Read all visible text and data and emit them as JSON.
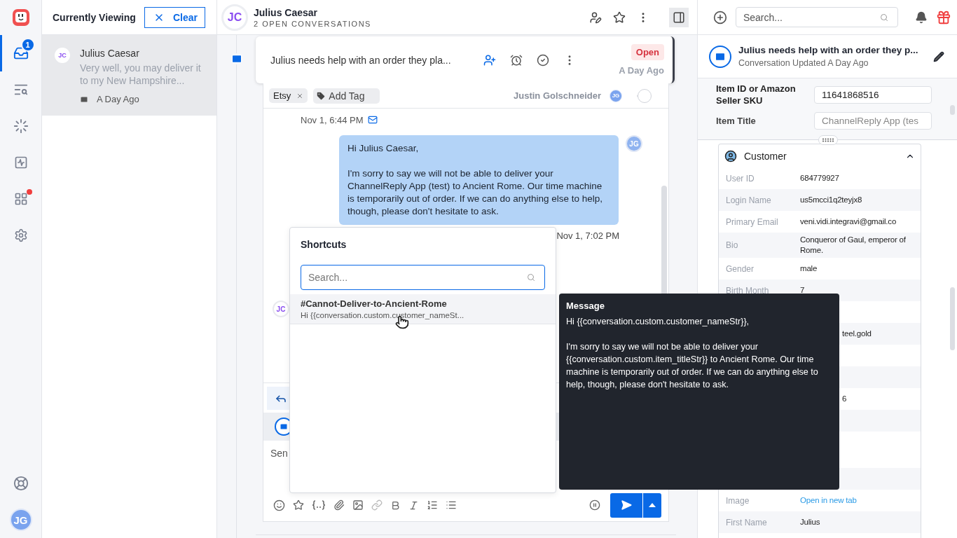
{
  "rail": {
    "items": [
      {
        "kind": "inbox",
        "selected": true,
        "badge": "1",
        "alert": false
      },
      {
        "kind": "search",
        "selected": false,
        "alert": false
      },
      {
        "kind": "reports",
        "selected": false,
        "alert": false
      },
      {
        "kind": "activity",
        "selected": false,
        "alert": false
      },
      {
        "kind": "apps",
        "selected": false,
        "alert": true
      },
      {
        "kind": "settings",
        "selected": false,
        "alert": false
      }
    ],
    "avatar": "JG"
  },
  "list": {
    "title": "Currently Viewing",
    "clear_button": "Clear",
    "items": [
      {
        "avatar": "JC",
        "name": "Julius Caesar",
        "preview": "Very well, you may deliver it to my New Hampshire...",
        "time": "A Day Ago",
        "selected": true
      }
    ]
  },
  "conversation": {
    "avatar": "JC",
    "name": "Julius Caesar",
    "subtitle": "2 OPEN CONVERSATIONS",
    "summary": {
      "subject": "Julius needs help with an order they pla...",
      "status": "Open",
      "time": "A Day Ago"
    },
    "tags": [
      "Etsy"
    ],
    "add_tag": "Add Tag",
    "assignee": "Justin Golschneider",
    "assignee_avatar": "JG",
    "messages": [
      {
        "kind": "timestamp",
        "text": "Nov 1, 6:44 PM"
      },
      {
        "kind": "outgoing",
        "avatar": "JG",
        "text": "Hi Julius Caesar,\n\nI'm sorry to say we will not be able to deliver your ChannelReply App (test) to Ancient Rome. Our time machine is temporarily out of order. If we can do anything else to help, though, please don't hesitate to ask."
      },
      {
        "kind": "time",
        "text": "Nov 1, 7:02 PM"
      },
      {
        "kind": "incoming",
        "avatar": "JC"
      }
    ],
    "composer": {
      "draft": "Sen"
    }
  },
  "shortcuts": {
    "title": "Shortcuts",
    "search": {
      "placeholder": "Search..."
    },
    "items": [
      {
        "name": "#Cannot-Deliver-to-Ancient-Rome",
        "preview": "Hi {{conversation.custom.customer_nameSt...",
        "selected": true
      }
    ]
  },
  "tooltip": {
    "title": "Message",
    "text": "Hi {{conversation.custom.customer_nameStr}},\n\nI'm sorry to say we will not be able to deliver your {{conversation.custom.item_titleStr}} to Ancient Rome. Our time machine is temporarily out of order. If we can do anything else to help, though, please don't hesitate to ask."
  },
  "side": {
    "search": {
      "placeholder": "Search..."
    },
    "summary": {
      "title": "Julius needs help with an order they p...",
      "subtitle": "Conversation Updated A Day Ago"
    },
    "fields": [
      {
        "label": "Item ID or Amazon Seller SKU",
        "value": "11641868516",
        "disabled": false
      },
      {
        "label": "Item Title",
        "value": "ChannelReply App (tes",
        "disabled": true
      }
    ],
    "customer": {
      "title": "Customer",
      "expanded": true,
      "rows": [
        {
          "label": "User ID",
          "value": "684779927"
        },
        {
          "label": "Login Name",
          "value": "us5mcci1q2teyjx8"
        },
        {
          "label": "Primary Email",
          "value": "veni.vidi.integravi@gmail.co"
        },
        {
          "label": "Bio",
          "value": "Conqueror of Gaul, emperor of Rome."
        },
        {
          "label": "Gender",
          "value": "male"
        },
        {
          "label": "Birth Month",
          "value": "7"
        },
        {},
        {
          "value": "teel.gold"
        },
        {},
        {},
        {
          "value": "6"
        },
        {},
        {
          "tall": true
        },
        {},
        {
          "label": "Image",
          "value": "Open in new tab",
          "link": true
        },
        {
          "label": "First Name",
          "value": "Julius"
        }
      ]
    }
  }
}
